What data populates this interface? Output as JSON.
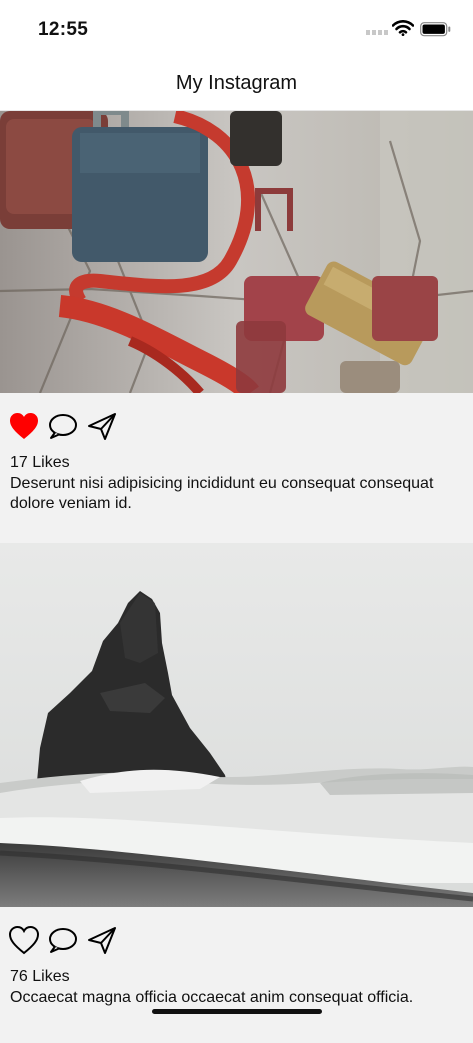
{
  "status_bar": {
    "time": "12:55",
    "icons": [
      "signal-icon",
      "wifi-icon",
      "battery-icon"
    ]
  },
  "nav": {
    "title": "My Instagram"
  },
  "posts": [
    {
      "image": "padlocks-on-fence-photo",
      "liked": true,
      "likes": "17 Likes",
      "caption": "Deserunt nisi adipisicing incididunt eu consequat consequat dolore veniam id.",
      "icons": [
        "heart-filled-icon",
        "comment-icon",
        "share-icon"
      ]
    },
    {
      "image": "sea-stack-beach-photo",
      "liked": false,
      "likes": "76 Likes",
      "caption": "Occaecat magna officia occaecat anim consequat officia.",
      "icons": [
        "heart-outline-icon",
        "comment-icon",
        "share-icon"
      ]
    }
  ],
  "colors": {
    "like_active": "#ff0000",
    "background": "#f2f2f2",
    "bar": "#ffffff",
    "text": "#111111"
  }
}
